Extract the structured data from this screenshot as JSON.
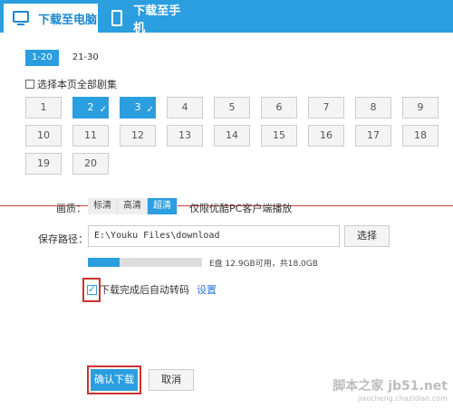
{
  "tabs": {
    "pc": "下载至电脑",
    "phone": "下载至手机"
  },
  "range_tabs": [
    "1-20",
    "21-30"
  ],
  "select_all": "选择本页全部剧集",
  "episodes": [
    {
      "num": "1",
      "selected": false
    },
    {
      "num": "2",
      "selected": true
    },
    {
      "num": "3",
      "selected": true
    },
    {
      "num": "4",
      "selected": false
    },
    {
      "num": "5",
      "selected": false
    },
    {
      "num": "6",
      "selected": false
    },
    {
      "num": "7",
      "selected": false
    },
    {
      "num": "8",
      "selected": false
    },
    {
      "num": "9",
      "selected": false
    },
    {
      "num": "10",
      "selected": false
    },
    {
      "num": "11",
      "selected": false
    },
    {
      "num": "12",
      "selected": false
    },
    {
      "num": "13",
      "selected": false
    },
    {
      "num": "14",
      "selected": false
    },
    {
      "num": "15",
      "selected": false
    },
    {
      "num": "16",
      "selected": false
    },
    {
      "num": "17",
      "selected": false
    },
    {
      "num": "18",
      "selected": false
    },
    {
      "num": "19",
      "selected": false
    },
    {
      "num": "20",
      "selected": false
    }
  ],
  "quality": {
    "label": "画质：",
    "options": [
      "标清",
      "高清",
      "超清"
    ],
    "selected": "超清",
    "note": "仅限优酷PC客户端播放"
  },
  "save_path": {
    "label": "保存路径：",
    "value": "E:\\Youku Files\\download",
    "browse": "选择"
  },
  "disk": {
    "used_fraction": 0.28,
    "text": "E盘 12.9GB可用，共18.0GB"
  },
  "auto_convert": {
    "checked": true,
    "label": "下载完成后自动转码",
    "settings": "设置"
  },
  "buttons": {
    "confirm": "确认下载",
    "cancel": "取消"
  },
  "watermark": {
    "line1": "脚本之家 jb51.net",
    "line2": "jiaocheng.chazidian.com"
  },
  "colors": {
    "accent": "#2b9ee0",
    "highlight": "#d03030"
  }
}
